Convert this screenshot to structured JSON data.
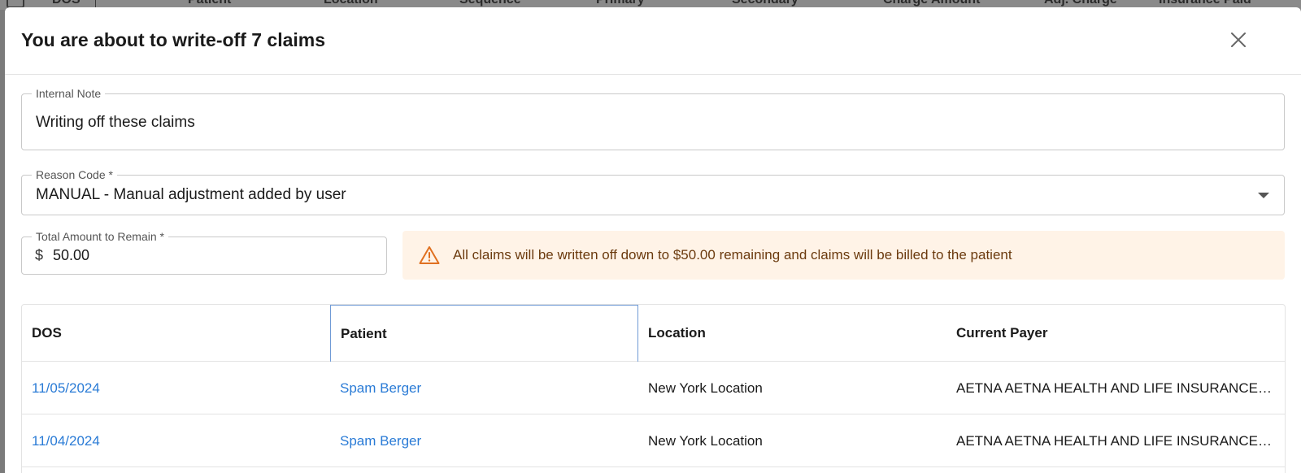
{
  "background_header": {
    "columns": [
      "DOS",
      "Patient",
      "Location",
      "Sequence",
      "Primary",
      "Secondary",
      "Charge Amount",
      "Adj. Charge",
      "Insurance Paid"
    ]
  },
  "modal": {
    "title": "You are about to write-off 7 claims",
    "close_icon": "close-icon",
    "internal_note": {
      "label": "Internal Note",
      "value": "Writing off these claims"
    },
    "reason_code": {
      "label": "Reason Code *",
      "value": "MANUAL - Manual adjustment added by user"
    },
    "total_amount": {
      "label": "Total Amount to Remain *",
      "currency": "$",
      "value": "50.00"
    },
    "alert": {
      "icon": "warning-icon",
      "text": "All claims will be written off down to $50.00 remaining and claims will be billed to the patient",
      "background": "#fff3e7",
      "icon_color": "#e07020"
    },
    "table": {
      "columns": [
        "DOS",
        "Patient",
        "Location",
        "Current Payer"
      ],
      "rows": [
        [
          "11/05/2024",
          "Spam Berger",
          "New York Location",
          "AETNA AETNA HEALTH AND LIFE INSURANCE COMPANY"
        ],
        [
          "11/04/2024",
          "Spam Berger",
          "New York Location",
          "AETNA AETNA HEALTH AND LIFE INSURANCE COMPANY"
        ]
      ]
    }
  },
  "colors": {
    "link": "#2a7bd6",
    "active_column_border": "#6f9bd6"
  }
}
